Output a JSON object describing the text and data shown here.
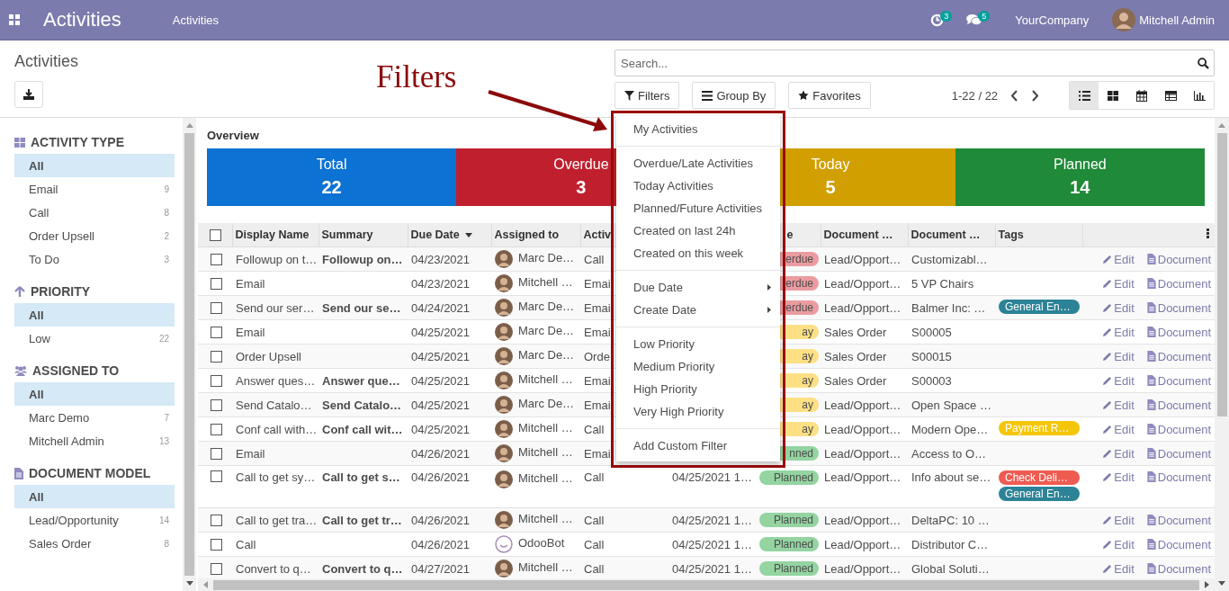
{
  "navbar": {
    "app_title": "Activities",
    "menu": [
      "Activities"
    ],
    "activity_count": "3",
    "message_count": "5",
    "company": "YourCompany",
    "user": "Mitchell Admin"
  },
  "breadcrumb": "Activities",
  "search": {
    "placeholder": "Search..."
  },
  "filter_buttons": [
    "Filters",
    "Group By",
    "Favorites"
  ],
  "pager": "1-22 / 22",
  "views": [
    {
      "kind": "list",
      "selected": true
    },
    {
      "kind": "kanban",
      "selected": false
    },
    {
      "kind": "calendar",
      "selected": false
    },
    {
      "kind": "pivot",
      "selected": false
    },
    {
      "kind": "graph",
      "selected": false
    }
  ],
  "sidebar": [
    {
      "title": "ACTIVITY TYPE",
      "items": [
        {
          "label": "All",
          "selected": true
        },
        {
          "label": "Email",
          "count": "9",
          "selected": false
        },
        {
          "label": "Call",
          "count": "8",
          "selected": false
        },
        {
          "label": "Order Upsell",
          "count": "2",
          "selected": false
        },
        {
          "label": "To Do",
          "count": "3",
          "selected": false
        }
      ]
    },
    {
      "title": "PRIORITY",
      "items": [
        {
          "label": "All",
          "selected": true
        },
        {
          "label": "Low",
          "count": "22",
          "selected": false
        }
      ]
    },
    {
      "title": "ASSIGNED TO",
      "items": [
        {
          "label": "All",
          "selected": true
        },
        {
          "label": "Marc Demo",
          "count": "7",
          "selected": false
        },
        {
          "label": "Mitchell Admin",
          "count": "13",
          "selected": false
        }
      ]
    },
    {
      "title": "DOCUMENT MODEL",
      "items": [
        {
          "label": "All",
          "selected": true
        },
        {
          "label": "Lead/Opportunity",
          "count": "14",
          "selected": false
        },
        {
          "label": "Sales Order",
          "count": "8",
          "selected": false
        }
      ]
    }
  ],
  "overview": {
    "title": "Overview",
    "cards": [
      {
        "label": "Total",
        "value": "22",
        "color": "#0c72d4"
      },
      {
        "label": "Overdue",
        "value": "3",
        "color": "#c0202e"
      },
      {
        "label": "Today",
        "value": "5",
        "color": "#d29f00"
      },
      {
        "label": "Planned",
        "value": "14",
        "color": "#1f8a38"
      }
    ]
  },
  "table": {
    "all_selected": false,
    "columns": [
      {
        "label": "Display Name",
        "sort_descending": false
      },
      {
        "label": "Summary",
        "sort_descending": false
      },
      {
        "label": "Due Date",
        "sort_descending": true
      },
      {
        "label": "Assigned to",
        "sort_descending": false
      },
      {
        "label": "Activ",
        "sort_descending": false
      },
      {},
      {
        "label": "e",
        "sort_descending": false
      },
      {
        "label": "Document …",
        "sort_descending": false
      },
      {
        "label": "Document …",
        "sort_descending": false
      },
      {
        "label": "Tags",
        "sort_descending": false
      }
    ],
    "rows": [
      {
        "selected": false,
        "display_name": "Followup on t…",
        "summary": "Followup on…",
        "due_date": "04/23/2021",
        "assignee": {
          "name": "Marc De…",
          "kind": "person"
        },
        "activity": "Call",
        "state": {
          "text": "erdue",
          "kind": "overdue"
        },
        "document_model": "Lead/Opport…",
        "document_name": "Customizabl…",
        "edit": "Edit",
        "document": "Document"
      },
      {
        "selected": false,
        "display_name": "Email",
        "due_date": "04/23/2021",
        "assignee": {
          "name": "Mitchell …",
          "kind": "person"
        },
        "activity": "Emai",
        "state": {
          "text": "erdue",
          "kind": "overdue"
        },
        "document_model": "Lead/Opport…",
        "document_name": "5 VP Chairs",
        "edit": "Edit",
        "document": "Document"
      },
      {
        "selected": false,
        "display_name": "Send our ser…",
        "summary": "Send our se…",
        "due_date": "04/24/2021",
        "assignee": {
          "name": "Marc De…",
          "kind": "person"
        },
        "activity": "Emai",
        "state": {
          "text": "erdue",
          "kind": "overdue"
        },
        "document_model": "Lead/Opport…",
        "document_name": "Balmer Inc: …",
        "tags": [
          {
            "label": "General En…",
            "color": "#2c8397"
          }
        ],
        "edit": "Edit",
        "document": "Document"
      },
      {
        "selected": false,
        "display_name": "Email",
        "due_date": "04/25/2021",
        "assignee": {
          "name": "Marc De…",
          "kind": "person"
        },
        "activity": "Emai",
        "state": {
          "text": "ay",
          "kind": "today"
        },
        "document_model": "Sales Order",
        "document_name": "S00005",
        "edit": "Edit",
        "document": "Document"
      },
      {
        "selected": false,
        "display_name": "Order Upsell",
        "due_date": "04/25/2021",
        "assignee": {
          "name": "Marc De…",
          "kind": "person"
        },
        "activity": "Orde",
        "state": {
          "text": "ay",
          "kind": "today"
        },
        "document_model": "Sales Order",
        "document_name": "S00015",
        "edit": "Edit",
        "document": "Document"
      },
      {
        "selected": false,
        "display_name": "Answer ques…",
        "summary": "Answer que…",
        "due_date": "04/25/2021",
        "assignee": {
          "name": "Mitchell …",
          "kind": "person"
        },
        "activity": "Emai",
        "state": {
          "text": "ay",
          "kind": "today"
        },
        "document_model": "Sales Order",
        "document_name": "S00003",
        "edit": "Edit",
        "document": "Document"
      },
      {
        "selected": false,
        "display_name": "Send Catalo…",
        "summary": "Send Catalo…",
        "due_date": "04/25/2021",
        "assignee": {
          "name": "Marc De…",
          "kind": "person"
        },
        "activity": "Emai",
        "state": {
          "text": "ay",
          "kind": "today"
        },
        "document_model": "Lead/Opport…",
        "document_name": "Open Space …",
        "edit": "Edit",
        "document": "Document"
      },
      {
        "selected": false,
        "display_name": "Conf call with…",
        "summary": "Conf call wit…",
        "due_date": "04/25/2021",
        "assignee": {
          "name": "Mitchell …",
          "kind": "person"
        },
        "activity": "Call",
        "state": {
          "text": "ay",
          "kind": "today"
        },
        "document_model": "Lead/Opport…",
        "document_name": "Modern Ope…",
        "tags": [
          {
            "label": "Payment R…",
            "color": "#f4c609"
          }
        ],
        "edit": "Edit",
        "document": "Document"
      },
      {
        "selected": false,
        "display_name": "Email",
        "due_date": "04/26/2021",
        "assignee": {
          "name": "Mitchell …",
          "kind": "person"
        },
        "activity": "Emai",
        "state": {
          "text": "nned",
          "kind": "planned"
        },
        "document_model": "Lead/Opport…",
        "document_name": "Access to O…",
        "edit": "Edit",
        "document": "Document"
      },
      {
        "selected": false,
        "display_name": "Call to get sy…",
        "summary": "Call to get s…",
        "due_date": "04/26/2021",
        "assignee": {
          "name": "Mitchell …",
          "kind": "person"
        },
        "activity": "Call",
        "column_6": "04/25/2021 1…",
        "state": {
          "text": "Planned",
          "kind": "planned"
        },
        "document_model": "Lead/Opport…",
        "document_name": "Info about se…",
        "tags": [
          {
            "label": "Check Deli…",
            "color": "#ef5b51"
          },
          {
            "label": "General En…",
            "color": "#2c8397"
          }
        ],
        "edit": "Edit",
        "document": "Document"
      },
      {
        "selected": false,
        "display_name": "Call to get tra…",
        "summary": "Call to get tr…",
        "due_date": "04/26/2021",
        "assignee": {
          "name": "Mitchell …",
          "kind": "person"
        },
        "activity": "Call",
        "column_6": "04/25/2021 1…",
        "state": {
          "text": "Planned",
          "kind": "planned"
        },
        "document_model": "Lead/Opport…",
        "document_name": "DeltaPC: 10 …",
        "edit": "Edit",
        "document": "Document"
      },
      {
        "selected": false,
        "display_name": "Call",
        "due_date": "04/26/2021",
        "assignee": {
          "name": "OdooBot",
          "kind": "bot"
        },
        "activity": "Call",
        "column_6": "04/25/2021 1…",
        "state": {
          "text": "Planned",
          "kind": "planned"
        },
        "document_model": "Lead/Opport…",
        "document_name": "Distributor C…",
        "edit": "Edit",
        "document": "Document"
      },
      {
        "selected": false,
        "display_name": "Convert to q…",
        "summary": "Convert to q…",
        "due_date": "04/27/2021",
        "assignee": {
          "name": "Mitchell …",
          "kind": "person"
        },
        "activity": "Call",
        "column_6": "04/25/2021 1…",
        "state": {
          "text": "Planned",
          "kind": "planned"
        },
        "document_model": "Lead/Opport…",
        "document_name": "Global Soluti…",
        "edit": "Edit",
        "document": "Document"
      }
    ]
  },
  "filters_menu": {
    "groups": [
      [
        {
          "label": "My Activities",
          "submenu": false
        }
      ],
      [
        {
          "label": "Overdue/Late Activities",
          "submenu": false
        },
        {
          "label": "Today Activities",
          "submenu": false
        },
        {
          "label": "Planned/Future Activities",
          "submenu": false
        },
        {
          "label": "Created on last 24h",
          "submenu": false
        },
        {
          "label": "Created on this week",
          "submenu": false
        }
      ],
      [
        {
          "label": "Due Date",
          "submenu": true
        },
        {
          "label": "Create Date",
          "submenu": true
        }
      ],
      [
        {
          "label": "Low Priority",
          "submenu": false
        },
        {
          "label": "Medium Priority",
          "submenu": false
        },
        {
          "label": "High Priority",
          "submenu": false
        },
        {
          "label": "Very High Priority",
          "submenu": false
        }
      ],
      [
        {
          "label": "Add Custom Filter",
          "submenu": false
        }
      ]
    ]
  },
  "annotation": {
    "text": "Filters"
  }
}
